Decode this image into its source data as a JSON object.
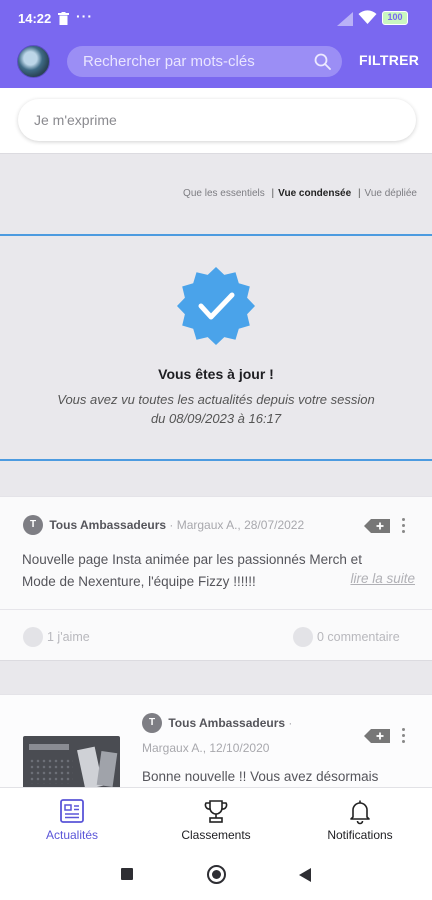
{
  "status_bar": {
    "time": "14:22",
    "dots": "···",
    "battery": "100"
  },
  "header": {
    "search_placeholder": "Rechercher par mots-clés",
    "filter_label": "FILTRER"
  },
  "compose": {
    "placeholder": "Je m'exprime"
  },
  "view_options": {
    "option_1": "Que les essentiels",
    "option_2": "Vue condensée",
    "option_3": "Vue dépliée",
    "separator": "|",
    "active": "Vue condensée"
  },
  "up_to_date": {
    "title": "Vous êtes à jour !",
    "line_1": "Vous avez vu toutes les actualités depuis votre session",
    "line_2": "du 08/09/2023 à 16:17"
  },
  "posts": [
    {
      "initial": "T",
      "group": "Tous Ambassadeurs",
      "meta": "· Margaux A., 28/07/2022",
      "text_line_1": "Nouvelle page Insta animée par les passionnés Merch et",
      "text_line_2": "Mode de Nexenture, l'équipe Fizzy !!!!!!",
      "read_more": "lire la suite",
      "likes": "1 j'aime",
      "comments": "0 commentaire"
    },
    {
      "initial": "T",
      "group": "Tous Ambassadeurs",
      "group_suffix": "·",
      "meta": "Margaux A., 12/10/2020",
      "text": "Bonne nouvelle !! Vous avez désormais"
    }
  ],
  "bottom_nav": {
    "items": [
      {
        "label": "Actualités",
        "icon": "newspaper-icon",
        "active": true
      },
      {
        "label": "Classements",
        "icon": "trophy-icon",
        "active": false
      },
      {
        "label": "Notifications",
        "icon": "bell-icon",
        "active": false
      }
    ]
  },
  "colors": {
    "header_purple": "#7a68f0",
    "accent_blue": "#4c9be0",
    "badge_blue": "#4aa3ea",
    "nav_active": "#5a55d8"
  }
}
